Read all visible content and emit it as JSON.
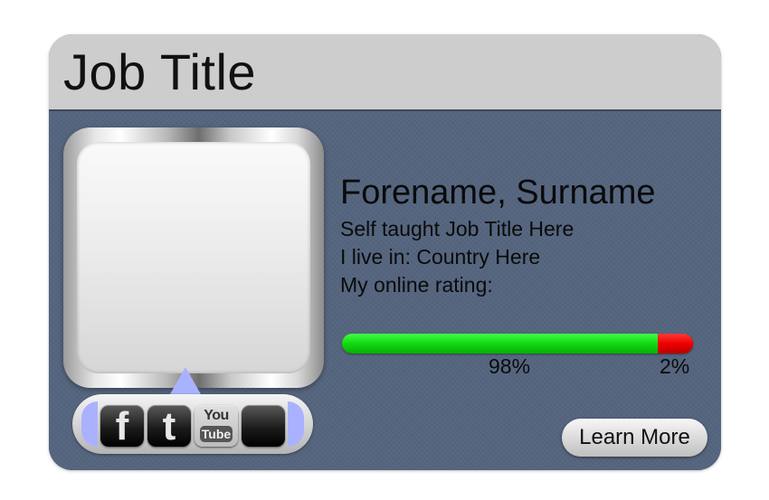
{
  "header": {
    "job_title": "Job Title"
  },
  "profile": {
    "name": "Forename, Surname",
    "tagline": "Self taught Job Title Here",
    "location": "I live in: Country Here",
    "rating_label": "My online rating:",
    "rating": {
      "positive_fraction": 0.98,
      "positive_label": "98%",
      "negative_label": "2%",
      "positive_color": "#12d812",
      "negative_color": "#ee0000"
    }
  },
  "social": {
    "facebook": {
      "icon": "facebook-icon",
      "glyph": "f"
    },
    "twitter": {
      "icon": "twitter-icon",
      "glyph": "t"
    },
    "youtube": {
      "icon": "youtube-icon",
      "top": "You",
      "bottom": "Tube"
    },
    "apple": {
      "icon": "apple-icon",
      "glyph": ""
    },
    "accent_color": "#a9b2ff"
  },
  "actions": {
    "learn_more": "Learn More"
  },
  "colors": {
    "card_body": "#55657f",
    "header_bg": "#cdcdcd"
  }
}
